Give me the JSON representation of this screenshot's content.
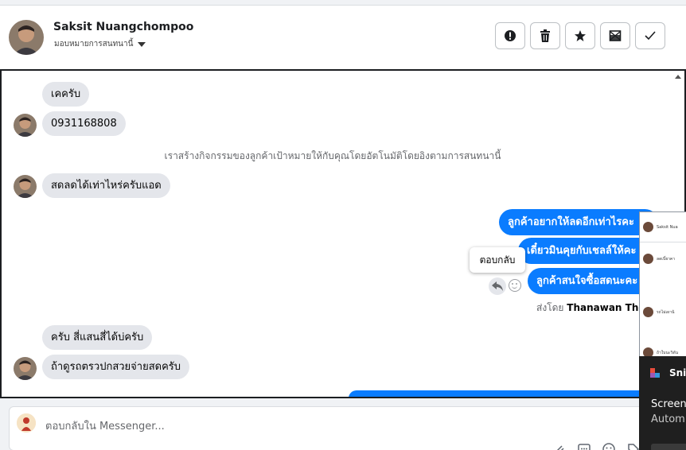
{
  "header": {
    "contact_name": "Saksit Nuangchompoo",
    "assign_label": "มอบหมายการสนทนานี้",
    "actions": [
      {
        "name": "report-button",
        "icon": "alert-circle-icon"
      },
      {
        "name": "delete-button",
        "icon": "trash-icon"
      },
      {
        "name": "star-button",
        "icon": "star-icon"
      },
      {
        "name": "mark-unread-button",
        "icon": "mail-x-icon"
      },
      {
        "name": "done-button",
        "icon": "check-icon"
      }
    ]
  },
  "thread": {
    "incoming_1": [
      "เคครับ",
      "0931168808"
    ],
    "system_note": "เราสร้างกิจกรรมของลูกค้าเป้าหมายให้กับคุณโดยอัตโนมัติโดยอิงตามการสนทนานี้",
    "incoming_2": "สดลดได้เท่าไหร่ครับแอด",
    "outgoing": [
      "ลูกค้าอยากให้ลดอีกเท่าไรคะ",
      "เดี๋ยวมินคุยกับเชลล์ให้คะ",
      "ลูกค้าสนใจซื้อสดนะคะ"
    ],
    "tooltip": "ตอบกลับ",
    "sent_by_prefix": "ส่งโดย",
    "sent_by_name": "Thanawan Thon",
    "incoming_3": [
      "ครับ สี่แสนสี่ได้บ่ครับ",
      "ถ้าดูรถตรวปกสวยจ่ายสดครับ"
    ]
  },
  "composer": {
    "placeholder": "ตอบกลับใน Messenger..."
  },
  "side_panel": {
    "rows": [
      "Saksit Nua",
      "ลดเบิ้ยาคา",
      "รถไม่เผาน้",
      "ถ้าใบนะวิดัน"
    ]
  },
  "snip_toast": {
    "title": "Snip",
    "line1": "Screens",
    "line2": "Autom"
  },
  "colors": {
    "outgoing_bubble": "#0a7cff",
    "incoming_bubble": "#e4e6eb",
    "border": "#1c1e21"
  }
}
